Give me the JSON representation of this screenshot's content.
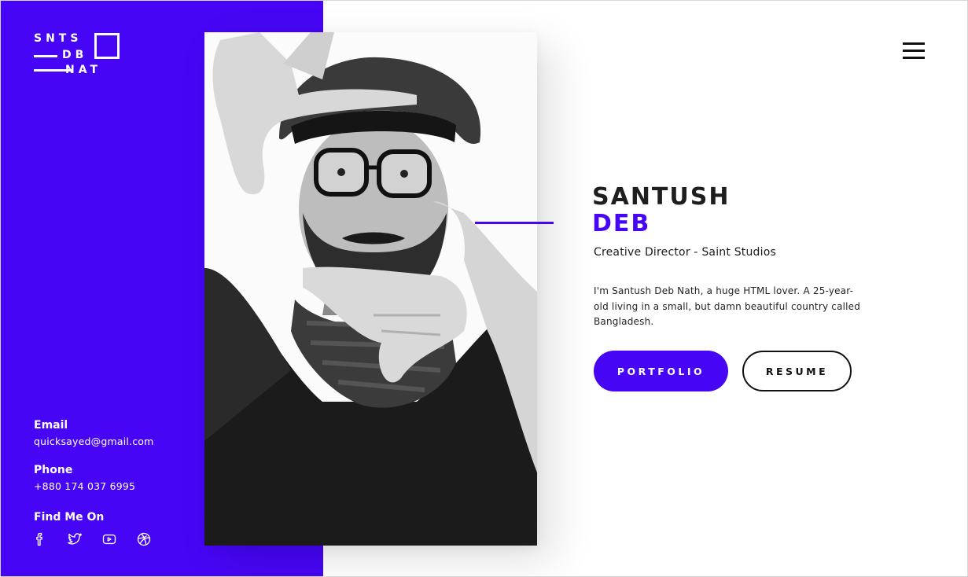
{
  "brand": {
    "logo_line1": "SNTS",
    "logo_line2": "DB",
    "logo_line3": "NAT",
    "accent_color": "#4606f5"
  },
  "header": {
    "menu_icon": "hamburger-menu-icon"
  },
  "hero": {
    "first_name": "SANTUSH",
    "last_name": "DEB",
    "role": "Creative Director - Saint Studios",
    "bio": "I'm Santush Deb Nath, a huge HTML lover. A 25-year-old living in a small, but damn beautiful country called Bangladesh.",
    "primary_button": "PORTFOLIO",
    "secondary_button": "RESUME"
  },
  "contact": {
    "email_label": "Email",
    "email": "quicksayed@gmail.com",
    "phone_label": "Phone",
    "phone": "+880 174 037 6995",
    "social_label": "Find Me On",
    "socials": [
      "facebook-icon",
      "twitter-icon",
      "youtube-icon",
      "dribbble-icon"
    ]
  },
  "photo": {
    "alt": "portrait-photo"
  }
}
